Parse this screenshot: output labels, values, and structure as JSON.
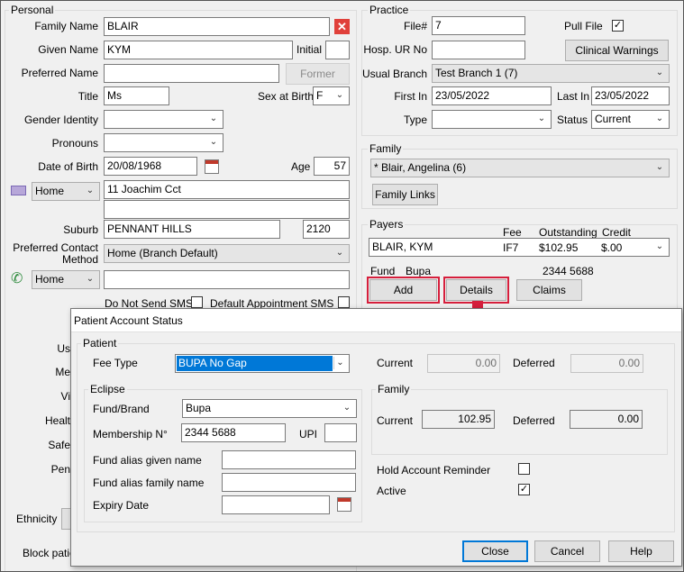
{
  "personal": {
    "title": "Personal",
    "family_name_label": "Family Name",
    "family_name": "BLAIR",
    "given_name_label": "Given Name",
    "given_name": "KYM",
    "initial_label": "Initial",
    "preferred_name_label": "Preferred Name",
    "former_label": "Former",
    "title_label": "Title",
    "title_value": "Ms",
    "sex_label": "Sex at Birth",
    "sex_value": "F",
    "gender_label": "Gender Identity",
    "pronouns_label": "Pronouns",
    "dob_label": "Date of Birth",
    "dob": "20/08/1968",
    "age_label": "Age",
    "age": "57",
    "address_type": "Home",
    "address1": "11 Joachim Cct",
    "suburb_label": "Suburb",
    "suburb": "PENNANT HILLS",
    "postcode": "2120",
    "pcm_label": "Preferred Contact Method",
    "pcm_value": "Home (Branch Default)",
    "phone_type": "Home",
    "no_sms_label": "Do Not Send SMS",
    "default_sms_label": "Default Appointment SMS",
    "partial_labels": [
      "Us",
      "Me",
      "Vi",
      "Healt",
      "Safe",
      "Pen"
    ],
    "ethnicity_label": "Ethnicity",
    "block_label": "Block patie"
  },
  "practice": {
    "title": "Practice",
    "file_label": "File#",
    "file_value": "7",
    "pull_file_label": "Pull File",
    "hosp_label": "Hosp. UR No",
    "clinical_warnings": "Clinical Warnings",
    "usual_branch_label": "Usual Branch",
    "usual_branch": "Test Branch 1  (7)",
    "first_in_label": "First In",
    "first_in": "23/05/2022",
    "last_in_label": "Last In",
    "last_in": "23/05/2022",
    "type_label": "Type",
    "status_label": "Status",
    "status_value": "Current"
  },
  "family": {
    "title": "Family",
    "member": "* Blair, Angelina (6)",
    "links_btn": "Family Links"
  },
  "payers": {
    "title": "Payers",
    "col_fee": "Fee",
    "col_outstanding": "Outstanding",
    "col_credit": "Credit",
    "payer_name": "BLAIR, KYM",
    "payer_fee": "IF7",
    "payer_outstanding": "$102.95",
    "payer_credit": "$.00",
    "fund_label": "Fund",
    "fund_value": "Bupa",
    "fund_number": "2344 5688",
    "add_btn": "Add",
    "details_btn": "Details",
    "claims_btn": "Claims"
  },
  "dialog": {
    "title": "Patient Account Status",
    "patient_group": "Patient",
    "fee_type_label": "Fee Type",
    "fee_type_value": "BUPA No Gap",
    "current_label": "Current",
    "current_value": "0.00",
    "deferred_label": "Deferred",
    "deferred_value": "0.00",
    "eclipse_group": "Eclipse",
    "fund_brand_label": "Fund/Brand",
    "fund_brand_value": "Bupa",
    "membership_label": "Membership N°",
    "membership_value": "2344 5688",
    "upi_label": "UPI",
    "alias_given_label": "Fund alias given name",
    "alias_family_label": "Fund alias family name",
    "expiry_label": "Expiry Date",
    "family_group": "Family",
    "fam_current_label": "Current",
    "fam_current_value": "102.95",
    "fam_deferred_label": "Deferred",
    "fam_deferred_value": "0.00",
    "hold_label": "Hold Account Reminder",
    "active_label": "Active",
    "close_btn": "Close",
    "cancel_btn": "Cancel",
    "help_btn": "Help"
  },
  "colors": {
    "highlight": "#d61f3c",
    "arrow": "#d61f3c",
    "selection": "#0078d7"
  }
}
